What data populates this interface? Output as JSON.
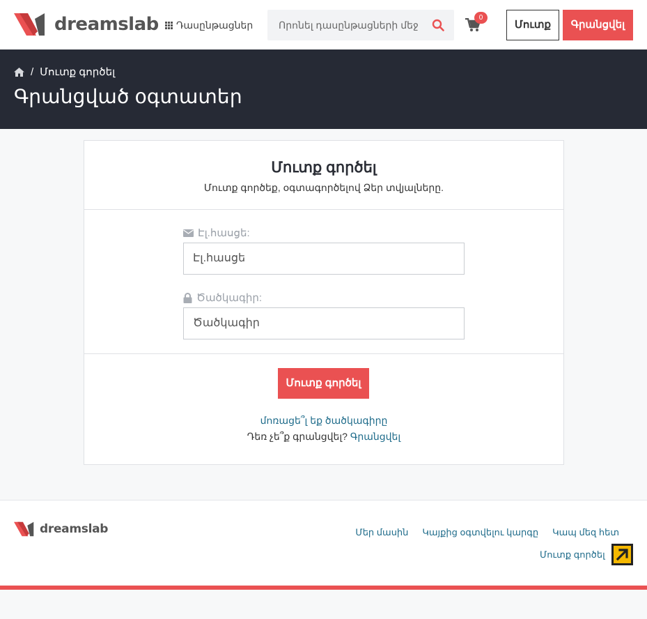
{
  "header": {
    "logo_text": "dreamslab",
    "courses_label": "Դասընթացներ",
    "search_placeholder": "Որոնել դասընթացների մեջ",
    "cart_count": "0",
    "login_label": "Մուտք",
    "register_label": "Գրանցվել"
  },
  "breadcrumb": {
    "current": "Մուտք գործել",
    "separator": "/",
    "page_title": "Գրանցված օգտատեր"
  },
  "login_card": {
    "title": "Մուտք գործել",
    "subtitle": "Մուտք գործեք, օգտագործելով Ձեր տվյալները.",
    "email_label": "Էլ.հասցե:",
    "email_placeholder": "Էլ.հասցե",
    "password_label": "Ծածկագիր:",
    "password_placeholder": "Ծածկագիր",
    "submit_label": "Մուտք գործել",
    "forgot_label": "մոռացե՞լ եք ծածկագիրը",
    "no_account_text": "Դեռ չե՞ք գրանցվել?",
    "register_link": "Գրանցվել"
  },
  "footer": {
    "logo_text": "dreamslab",
    "links": [
      "Մեր մասին",
      "Կայքից օգտվելու կարգը",
      "Կապ մեզ հետ"
    ],
    "login_link": "Մուտք գործել"
  },
  "colors": {
    "accent": "#ea5152",
    "dark_band": "#262a35",
    "link": "#1e6b8a",
    "scroll_top": "#f5b800"
  },
  "icons": [
    "grid-icon",
    "search-icon",
    "cart-icon",
    "home-icon",
    "envelope-icon",
    "lock-icon",
    "arrow-up-right-icon"
  ]
}
